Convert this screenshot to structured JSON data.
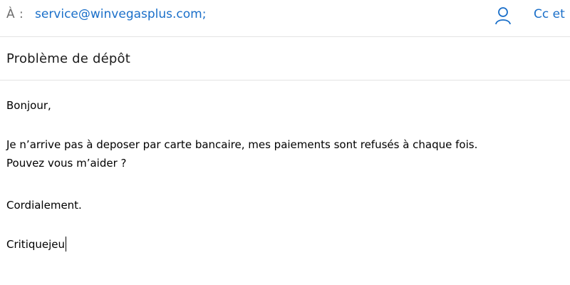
{
  "header": {
    "to_label": "À :",
    "recipient": "service@winvegasplus.com;",
    "cc_label": "Cc et",
    "person_icon": "person-icon",
    "accent_color": "#1a6fc9"
  },
  "subject": "Problème de dépôt",
  "body": {
    "greeting": "Bonjour,",
    "line1": "Je n’arrive pas à deposer par carte bancaire, mes paiements sont refusés à chaque fois.",
    "line2": "Pouvez vous m’aider ?",
    "closing": "Cordialement.",
    "signature": "Critiquejeu"
  }
}
